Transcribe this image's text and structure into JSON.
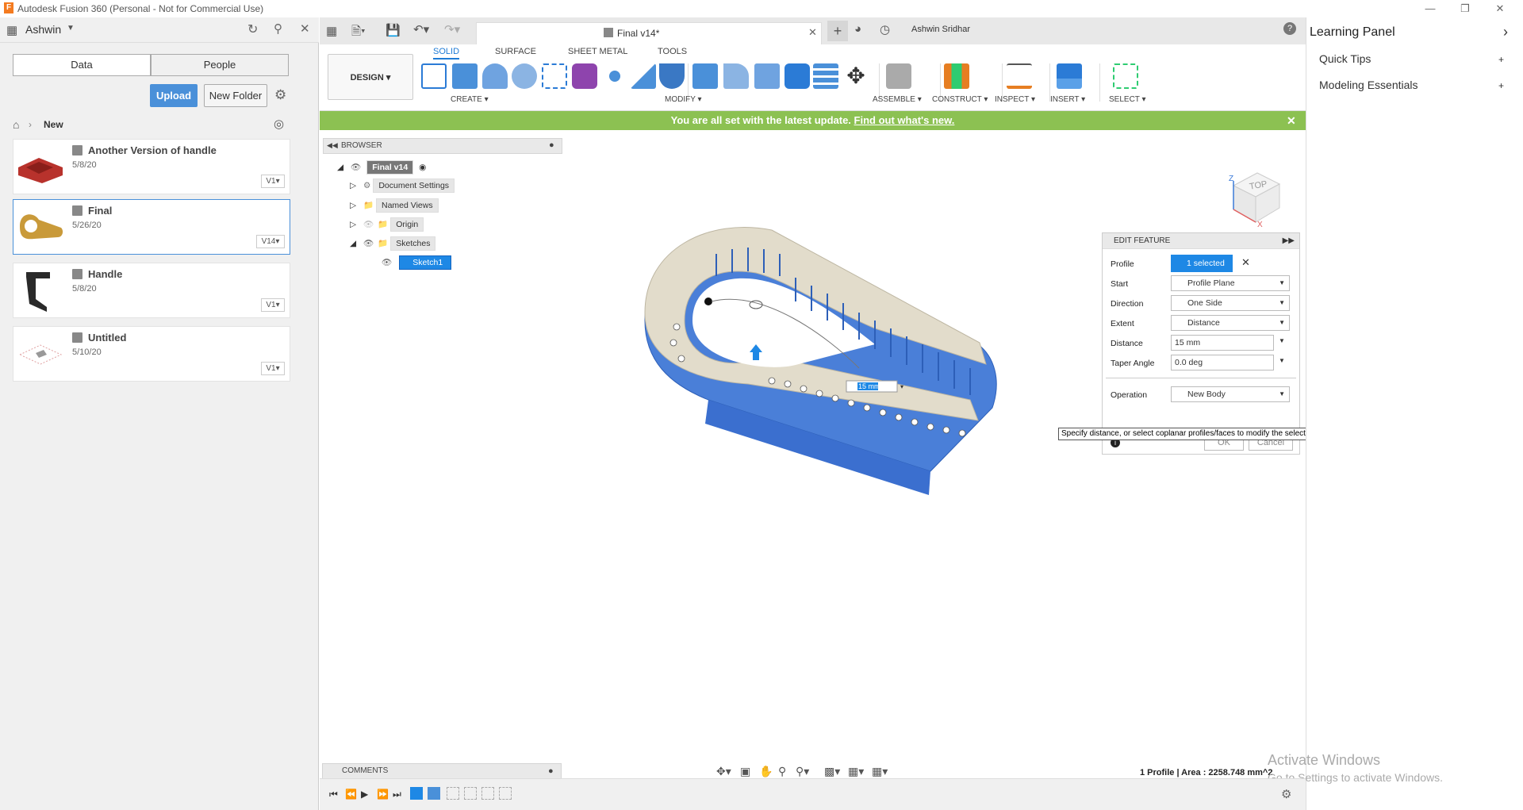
{
  "window": {
    "title": "Autodesk Fusion 360 (Personal - Not for Commercial Use)",
    "logo": "F"
  },
  "datapanel": {
    "user": "Ashwin",
    "tabs": [
      "Data",
      "People"
    ],
    "upload_label": "Upload",
    "new_folder_label": "New Folder",
    "breadcrumb": "New",
    "files": [
      {
        "name": "Another Version of handle",
        "date": "5/8/20",
        "version": "V1"
      },
      {
        "name": "Final",
        "date": "5/26/20",
        "version": "V14"
      },
      {
        "name": "Handle",
        "date": "5/8/20",
        "version": "V1"
      },
      {
        "name": "Untitled",
        "date": "5/10/20",
        "version": "V1"
      }
    ]
  },
  "doc": {
    "tab_title": "Final v14*",
    "user": "Ashwin Sridhar"
  },
  "toolbar": {
    "tabs": [
      "SOLID",
      "SURFACE",
      "SHEET METAL",
      "TOOLS"
    ],
    "design_label": "DESIGN",
    "groups": [
      "CREATE",
      "MODIFY",
      "ASSEMBLE",
      "CONSTRUCT",
      "INSPECT",
      "INSERT",
      "SELECT"
    ]
  },
  "banner": {
    "text": "You are all set with the latest update.",
    "link": "Find out what's new."
  },
  "browser": {
    "title": "BROWSER",
    "items": [
      "Final v14",
      "Document Settings",
      "Named Views",
      "Origin",
      "Sketches",
      "Sketch1"
    ]
  },
  "viewcube": {
    "face": "TOP"
  },
  "edit_feature": {
    "title": "EDIT FEATURE",
    "rows": [
      {
        "label": "Profile",
        "value": "1 selected"
      },
      {
        "label": "Start",
        "value": "Profile Plane"
      },
      {
        "label": "Direction",
        "value": "One Side"
      },
      {
        "label": "Extent",
        "value": "Distance"
      },
      {
        "label": "Distance",
        "value": "15 mm"
      },
      {
        "label": "Taper Angle",
        "value": "0.0 deg"
      },
      {
        "label": "Operation",
        "value": "New Body"
      }
    ],
    "ok": "OK",
    "cancel": "Cancel"
  },
  "tooltip": "Specify distance, or select coplanar profiles/faces to modify the selection",
  "dimension_input": "15 mm",
  "learning": {
    "title": "Learning Panel",
    "items": [
      "Quick Tips",
      "Modeling Essentials"
    ]
  },
  "comments": "COMMENTS",
  "status": "1 Profile | Area : 2258.748 mm^2",
  "activate": {
    "line1": "Activate Windows",
    "line2": "Go to Settings to activate Windows."
  },
  "colors": {
    "accent": "#1e7bd6",
    "banner": "#8cc152",
    "body": "#4a7fd8",
    "face": "#e2dccb"
  }
}
